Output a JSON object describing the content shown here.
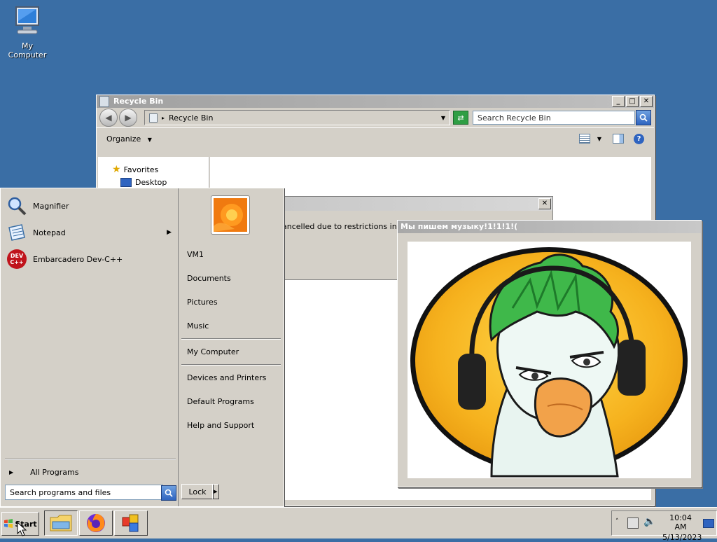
{
  "desktop": {
    "icon_label": "My Computer"
  },
  "recycle_bin": {
    "title": "Recycle Bin",
    "address": "Recycle Bin",
    "search_placeholder": "Search Recycle Bin",
    "organize_label": "Organize",
    "nav": {
      "favorites": "Favorites",
      "desktop": "Desktop"
    }
  },
  "dialog": {
    "message_fragment": "ancelled due to restrictions in effe"
  },
  "image_window": {
    "title": "Мы пишем музыку!1!1!1!("
  },
  "start_menu": {
    "programs": [
      {
        "label": "Magnifier",
        "icon": "magnifier-icon"
      },
      {
        "label": "Notepad",
        "icon": "notepad-icon",
        "has_submenu": true
      },
      {
        "label": "Embarcadero Dev-C++",
        "icon": "devcpp-icon",
        "icon_text": "DEV C++"
      }
    ],
    "all_programs": "All Programs",
    "search_placeholder": "Search programs and files",
    "lock_label": "Lock",
    "right_items": {
      "user": "VM1",
      "documents": "Documents",
      "pictures": "Pictures",
      "music": "Music",
      "my_computer": "My Computer",
      "devices": "Devices and Printers",
      "default_programs": "Default Programs",
      "help": "Help and Support"
    }
  },
  "taskbar": {
    "start_label": "Start",
    "clock_time": "10:04 AM",
    "clock_date": "5/13/2023"
  }
}
